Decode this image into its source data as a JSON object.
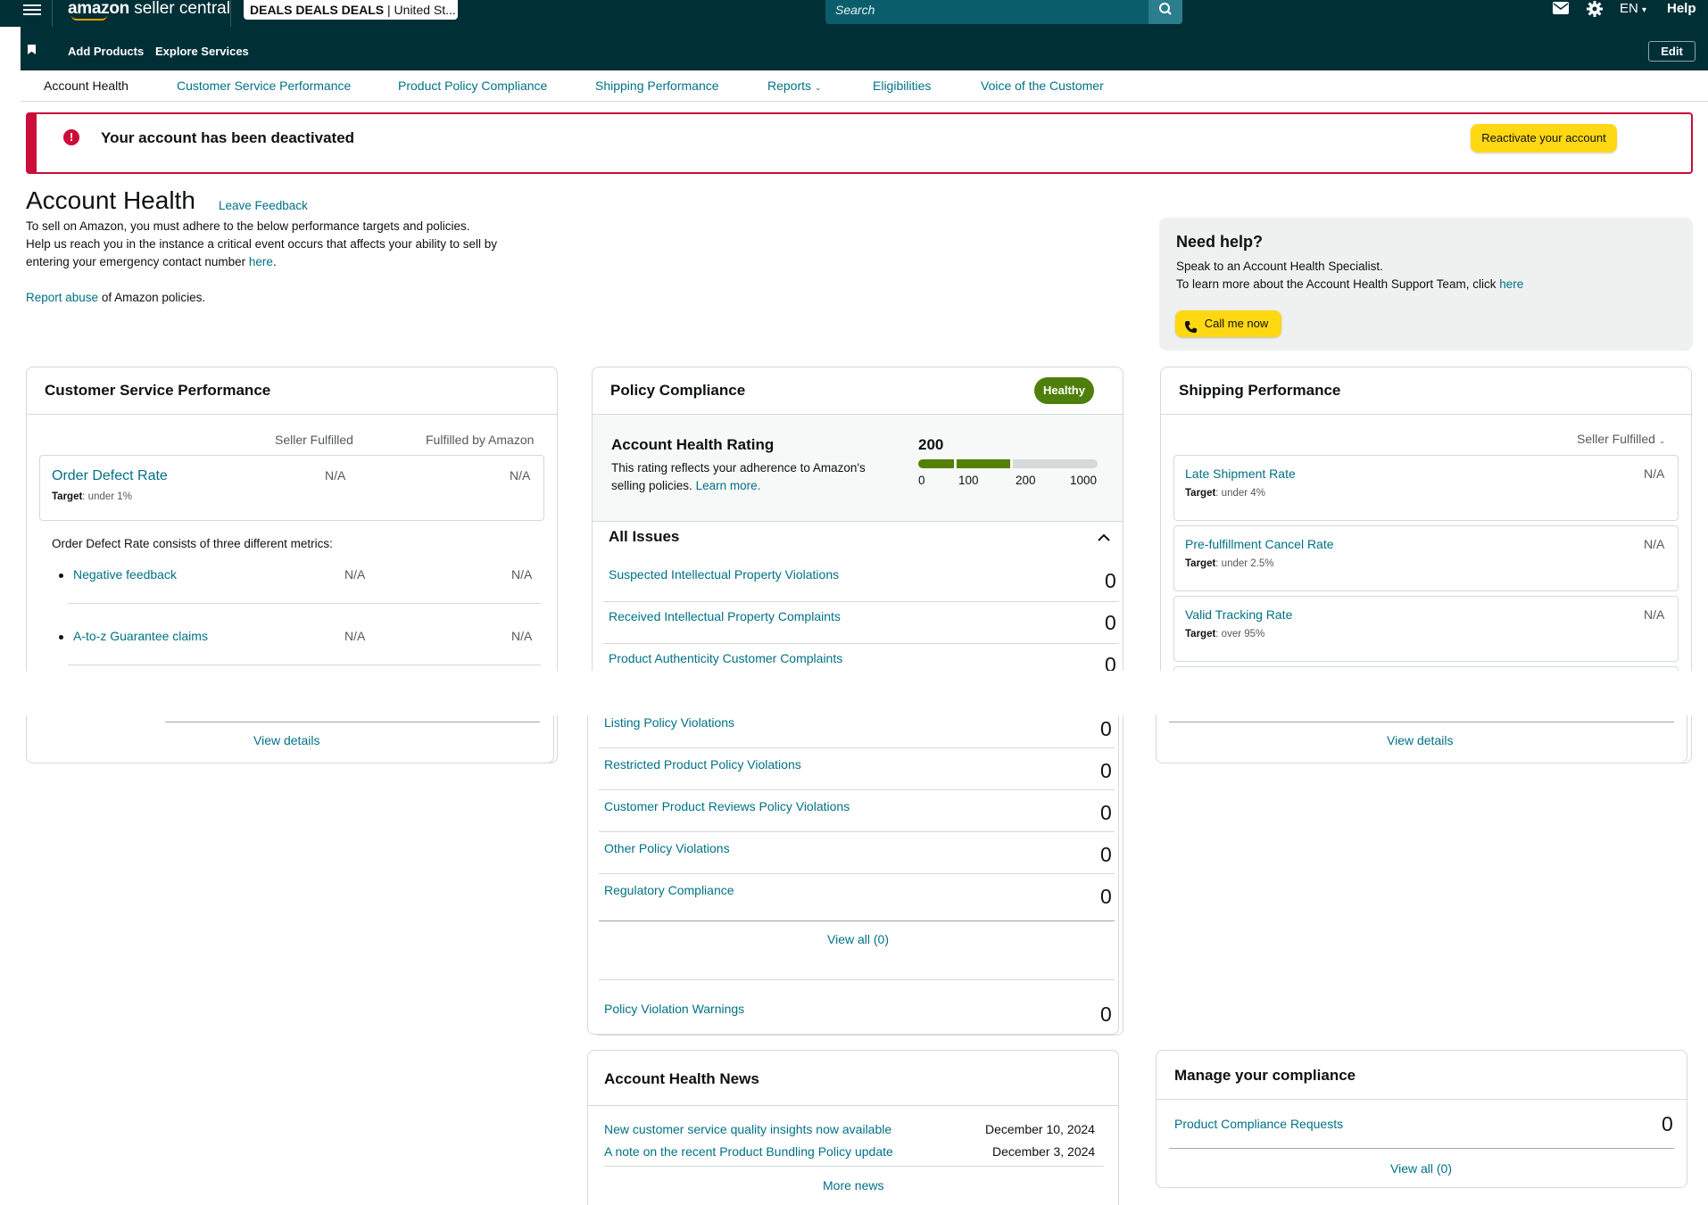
{
  "topbar": {
    "logo_brand": "amazon",
    "logo_suffix": "seller central",
    "store_name": "DEALS DEALS DEALS",
    "store_region": "| United St...",
    "search_placeholder": "Search",
    "language": "EN",
    "help_label": "Help"
  },
  "nav": {
    "add_products": "Add Products",
    "explore_services": "Explore Services",
    "edit_label": "Edit"
  },
  "tabs": [
    {
      "label": "Account Health"
    },
    {
      "label": "Customer Service Performance"
    },
    {
      "label": "Product Policy Compliance"
    },
    {
      "label": "Shipping Performance"
    },
    {
      "label": "Reports"
    },
    {
      "label": "Eligibilities"
    },
    {
      "label": "Voice of the Customer"
    }
  ],
  "alert": {
    "message": "Your account has been deactivated",
    "button": "Reactivate your account"
  },
  "header": {
    "title": "Account Health",
    "feedback_link": "Leave Feedback",
    "line1": "To sell on Amazon, you must adhere to the below performance targets and policies.",
    "line2": "Help us reach you in the instance a critical event occurs that affects your ability to sell by",
    "line3_prefix": "entering your emergency contact number",
    "line3_link": "here",
    "line3_suffix": ".",
    "report_link": "Report abuse",
    "report_suffix": " of Amazon policies."
  },
  "help": {
    "title": "Need help?",
    "line1": "Speak to an Account Health Specialist.",
    "line2_prefix": "To learn more about the Account Health Support Team, click",
    "line2_link": "here",
    "button": "Call me now"
  },
  "csp": {
    "title": "Customer Service Performance",
    "col1": "Seller Fulfilled",
    "col2": "Fulfilled by Amazon",
    "odr_label": "Order Defect Rate",
    "odr_target_label": "Target",
    "odr_target_value": ": under 1%",
    "odr_sf": "N/A",
    "odr_fba": "N/A",
    "consists": "Order Defect Rate consists of three different metrics:",
    "metrics": [
      {
        "label": "Negative feedback",
        "sf": "N/A",
        "fba": "N/A"
      },
      {
        "label": "A-to-z Guarantee claims",
        "sf": "N/A",
        "fba": "N/A"
      }
    ],
    "view_details": "View details"
  },
  "policy": {
    "title": "Policy Compliance",
    "status": "Healthy",
    "rating_title": "Account Health Rating",
    "rating_desc1": "This rating reflects your adherence to Amazon's",
    "rating_desc2": "selling policies.",
    "learn_more": "Learn more.",
    "rating_value": "200",
    "scale": [
      "0",
      "100",
      "200",
      "1000"
    ],
    "issues_title": "All Issues",
    "issues": [
      {
        "label": "Suspected Intellectual Property Violations",
        "count": "0"
      },
      {
        "label": "Received Intellectual Property Complaints",
        "count": "0"
      },
      {
        "label": "Product Authenticity Customer Complaints",
        "count": "0"
      },
      {
        "label": "Listing Policy Violations",
        "count": "0"
      },
      {
        "label": "Restricted Product Policy Violations",
        "count": "0"
      },
      {
        "label": "Customer Product Reviews Policy Violations",
        "count": "0"
      },
      {
        "label": "Other Policy Violations",
        "count": "0"
      },
      {
        "label": "Regulatory Compliance",
        "count": "0"
      }
    ],
    "view_all": "View all (0)",
    "warnings_label": "Policy Violation Warnings",
    "warnings_count": "0"
  },
  "shipping": {
    "title": "Shipping Performance",
    "filter": "Seller Fulfilled",
    "metrics": [
      {
        "label": "Late Shipment Rate",
        "target_label": "Target",
        "target_value": ": under 4%",
        "value": "N/A"
      },
      {
        "label": "Pre-fulfillment Cancel Rate",
        "target_label": "Target",
        "target_value": ": under 2.5%",
        "value": "N/A"
      },
      {
        "label": "Valid Tracking Rate",
        "target_label": "Target",
        "target_value": ": over 95%",
        "value": "N/A"
      }
    ],
    "view_details": "View details"
  },
  "news": {
    "title": "Account Health News",
    "items": [
      {
        "label": "New customer service quality insights now available",
        "date": "December 10, 2024"
      },
      {
        "label": "A note on the recent Product Bundling Policy update",
        "date": "December 3, 2024"
      }
    ],
    "more": "More news"
  },
  "compliance": {
    "title": "Manage your compliance",
    "item_label": "Product Compliance Requests",
    "item_count": "0",
    "view_all": "View all (0)"
  },
  "colors": {
    "header_bg": "#002f36",
    "link": "#007185",
    "alert": "#cc0c39",
    "button_yellow": "#ffd814",
    "healthy": "#4f7f0b",
    "rating_fill": "#538000"
  }
}
